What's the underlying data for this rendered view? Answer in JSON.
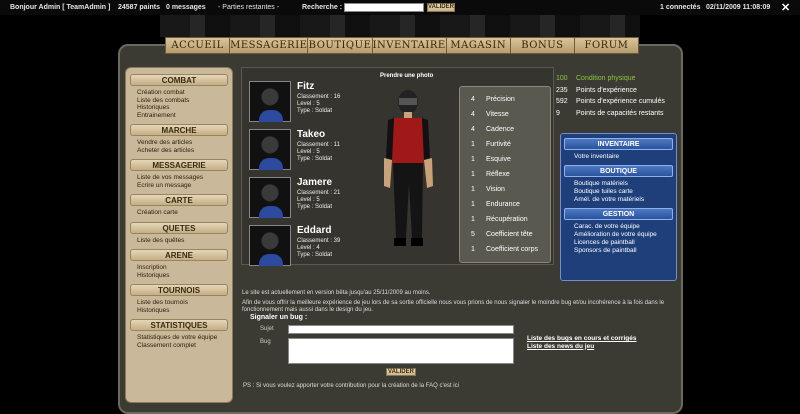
{
  "topbar": {
    "greeting": "Bonjour  Admin [ TeamAdmin ]",
    "paints": "24587 paints",
    "messages": "0 messages",
    "parties": "- Parties restantes -",
    "search_label": "Recherche :",
    "search_value": "",
    "search_button": "VALIDER",
    "connected": "1 connectés",
    "datetime": "02/11/2009 11:08:09",
    "close": "✕"
  },
  "nav": [
    "ACCUEIL",
    "MESSAGERIE",
    "BOUTIQUE",
    "INVENTAIRE",
    "MAGASIN",
    "BONUS",
    "FORUM"
  ],
  "sidebar": [
    {
      "title": "COMBAT",
      "links": [
        "Création combat",
        "Liste des combats",
        "Historiques",
        "Entrainement"
      ]
    },
    {
      "title": "MARCHE",
      "links": [
        "Vendre des articles",
        "Acheter des articles"
      ]
    },
    {
      "title": "MESSAGERIE",
      "links": [
        "Liste de vos messages",
        "Ecrire un message"
      ]
    },
    {
      "title": "CARTE",
      "links": [
        "Création carte"
      ]
    },
    {
      "title": "QUETES",
      "links": [
        "Liste des quêtes"
      ]
    },
    {
      "title": "ARENE",
      "links": [
        "Inscription",
        "Historiques"
      ]
    },
    {
      "title": "TOURNOIS",
      "links": [
        "Liste des tournois",
        "Historiques"
      ]
    },
    {
      "title": "STATISTIQUES",
      "links": [
        "Statistiques de votre équipe",
        "Classement complet"
      ]
    }
  ],
  "characters": [
    {
      "name": "Fitz",
      "rank": "Classement : 16",
      "level": "Level : 5",
      "type": "Type : Soldat"
    },
    {
      "name": "Takeo",
      "rank": "Classement : 11",
      "level": "Level : 5",
      "type": "Type : Soldat"
    },
    {
      "name": "Jamere",
      "rank": "Classement : 21",
      "level": "Level : 5",
      "type": "Type : Soldat"
    },
    {
      "name": "Eddard",
      "rank": "Classement : 39",
      "level": "Level : 4",
      "type": "Type : Soldat"
    }
  ],
  "photo_label": "Prendre une photo",
  "stats": [
    {
      "v": "4",
      "n": "Précision"
    },
    {
      "v": "4",
      "n": "Vitesse"
    },
    {
      "v": "4",
      "n": "Cadence"
    },
    {
      "v": "1",
      "n": "Furtivité"
    },
    {
      "v": "1",
      "n": "Esquive"
    },
    {
      "v": "1",
      "n": "Réflexe"
    },
    {
      "v": "1",
      "n": "Vision"
    },
    {
      "v": "1",
      "n": "Endurance"
    },
    {
      "v": "1",
      "n": "Récupération"
    },
    {
      "v": "5",
      "n": "Coefficient tête"
    },
    {
      "v": "1",
      "n": "Coefficient corps"
    }
  ],
  "condition": [
    {
      "v": "100",
      "n": "Condition physique"
    },
    {
      "v": "235",
      "n": "Points d'expérience"
    },
    {
      "v": "592",
      "n": "Points d'expérience cumulés"
    },
    {
      "v": "9",
      "n": "Points de capacités restants"
    }
  ],
  "rpanel": [
    {
      "title": "INVENTAIRE",
      "links": [
        "Votre inventaire"
      ]
    },
    {
      "title": "BOUTIQUE",
      "links": [
        "Boutique matériels",
        "Boutique tuiles carte",
        "Amél. de votre matériels"
      ]
    },
    {
      "title": "GESTION",
      "links": [
        "Carac. de votre équipe",
        "Amélioration de votre équipe",
        "Licences de paintball",
        "Sponsors de paintball"
      ]
    }
  ],
  "info1": "Le site est actuellement en version bêta jusqu'au 25/11/2009 au moins.",
  "info2": "Afin de vous offrir la meilleure expérience de jeu lors de sa sortie officielle nous vous prions de nous signaler le moindre bug et/ou incohérence à la fois dans le fonctionnement mais aussi dans le design du jeu.",
  "bug": {
    "title": "Signaler un bug :",
    "sujet": "Sujet",
    "bug": "Bug",
    "submit": "VALIDER",
    "link1": "Liste des bugs en cours et corrigés",
    "link2": "Liste des news du jeu"
  },
  "ps": "PS : Si vous voulez apporter votre contribution pour la création de la FAQ c'est ici",
  "colors": {
    "accent_green": "#8ec63f",
    "panel_blue": "#1e3f7a"
  }
}
